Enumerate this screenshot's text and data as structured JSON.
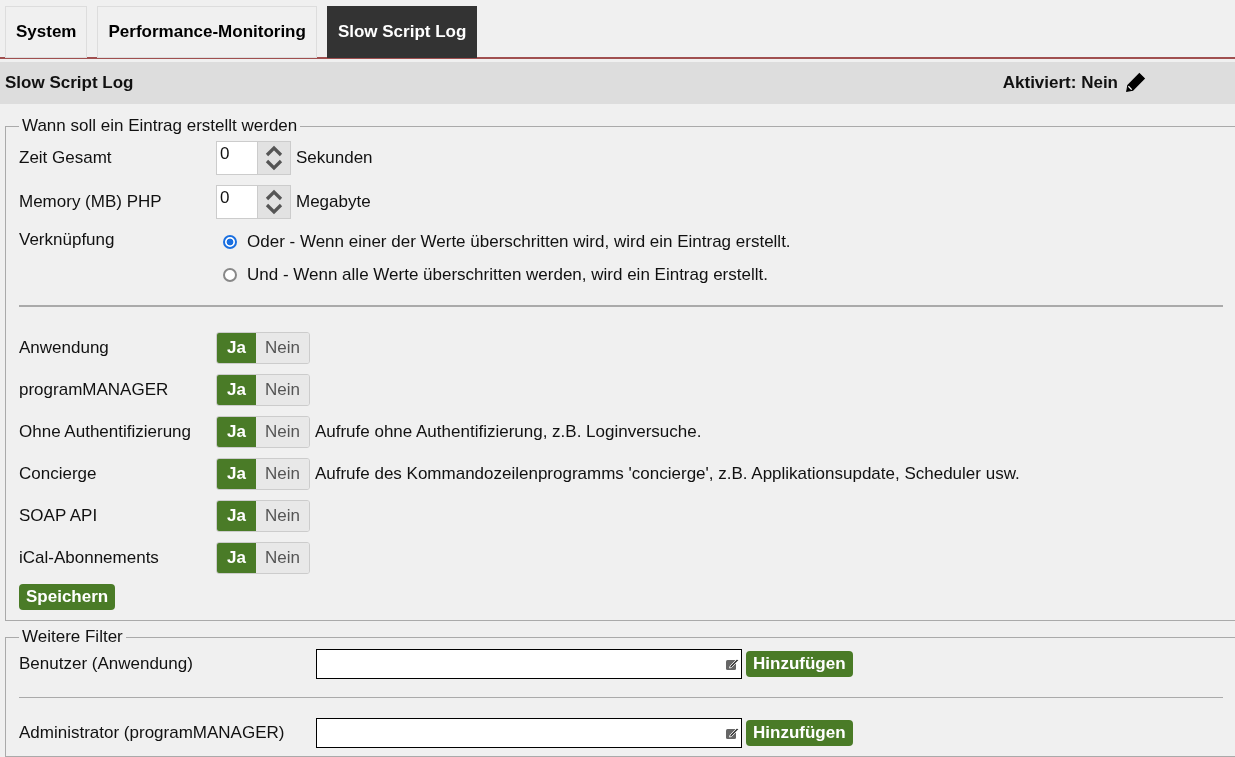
{
  "tabs": [
    {
      "label": "System",
      "selected": false
    },
    {
      "label": "Performance-Monitoring",
      "selected": false
    },
    {
      "label": "Slow Script Log",
      "selected": true
    }
  ],
  "header": {
    "title": "Slow Script Log",
    "status": "Aktiviert: Nein"
  },
  "entry_section": {
    "legend": "Wann soll ein Eintrag erstellt werden",
    "spinners": [
      {
        "label": "Zeit Gesamt",
        "value": "0",
        "unit": "Sekunden"
      },
      {
        "label": "Memory (MB) PHP",
        "value": "0",
        "unit": "Megabyte"
      }
    ],
    "link_label": "Verknüpfung",
    "radios": [
      {
        "label": "Oder - Wenn einer der Werte überschritten wird, wird ein Eintrag erstellt.",
        "selected": true
      },
      {
        "label": "Und - Wenn alle Werte überschritten werden, wird ein Eintrag erstellt.",
        "selected": false
      }
    ],
    "toggles": [
      {
        "label": "Anwendung",
        "options": [
          {
            "label": "Ja",
            "selected": true
          },
          {
            "label": "Nein",
            "selected": false
          }
        ]
      },
      {
        "label": "programMANAGER",
        "options": [
          {
            "label": "Ja",
            "selected": true
          },
          {
            "label": "Nein",
            "selected": false
          }
        ]
      },
      {
        "label": "Ohne Authentifizierung",
        "options": [
          {
            "label": "Ja",
            "selected": true
          },
          {
            "label": "Nein",
            "selected": false
          }
        ],
        "note": "Aufrufe ohne Authentifizierung, z.B. Loginversuche."
      },
      {
        "label": "Concierge",
        "options": [
          {
            "label": "Ja",
            "selected": true
          },
          {
            "label": "Nein",
            "selected": false
          }
        ],
        "note": "Aufrufe des Kommandozeilenprogramms 'concierge', z.B. Applikationsupdate, Scheduler usw."
      },
      {
        "label": "SOAP API",
        "options": [
          {
            "label": "Ja",
            "selected": true
          },
          {
            "label": "Nein",
            "selected": false
          }
        ]
      },
      {
        "label": "iCal-Abonnements",
        "options": [
          {
            "label": "Ja",
            "selected": true
          },
          {
            "label": "Nein",
            "selected": false
          }
        ]
      }
    ],
    "save_button": "Speichern"
  },
  "filter_section": {
    "legend": "Weitere Filter",
    "filters": [
      {
        "label": "Benutzer (Anwendung)",
        "button": "Hinzufügen"
      },
      {
        "label": "Administrator (programMANAGER)",
        "button": "Hinzufügen"
      }
    ]
  }
}
